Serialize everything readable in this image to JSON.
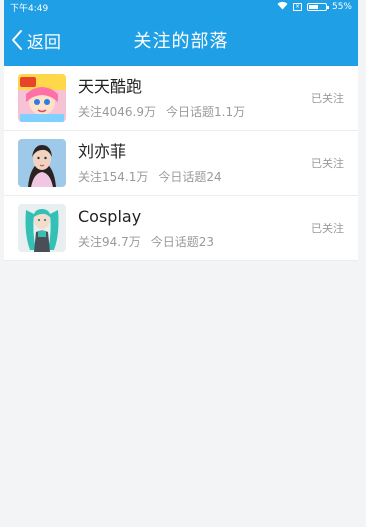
{
  "status_bar": {
    "time": "下午4:49",
    "battery": "55%",
    "battery_level": 0.55
  },
  "nav": {
    "back_label": "返回",
    "title": "关注的部落"
  },
  "tribes": [
    {
      "name": "天天酷跑",
      "followers": "关注4046.9万",
      "today_topics": "今日话题1.1万",
      "status": "已关注",
      "avatar_icon": "game-avatar"
    },
    {
      "name": "刘亦菲",
      "followers": "关注154.1万",
      "today_topics": "今日话题24",
      "status": "已关注",
      "avatar_icon": "portrait-avatar"
    },
    {
      "name": "Cosplay",
      "followers": "关注94.7万",
      "today_topics": "今日话题23",
      "status": "已关注",
      "avatar_icon": "cosplay-avatar"
    }
  ],
  "colors": {
    "accent": "#1f9fe5",
    "background": "#f3f4f6"
  }
}
